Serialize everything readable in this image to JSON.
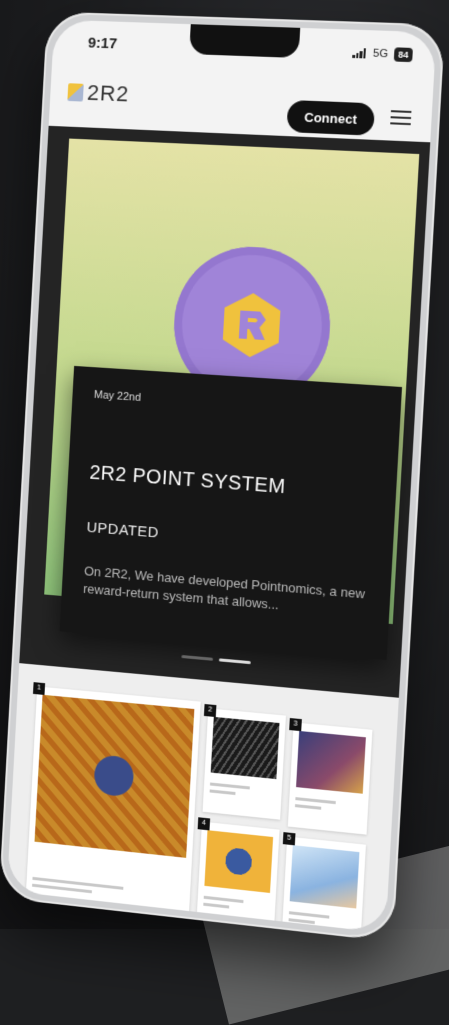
{
  "status_bar": {
    "time": "9:17",
    "network": "5G",
    "battery": "84"
  },
  "header": {
    "logo_text": "2R2",
    "connect_label": "Connect"
  },
  "hero": {
    "news": {
      "date": "May 22nd",
      "title": "2R2 POINT SYSTEM",
      "subtitle": "UPDATED",
      "body": "On 2R2, We have developed Pointnomics, a new reward-return system that allows..."
    },
    "carousel": {
      "pages": 2,
      "active_index": 1
    }
  },
  "colors": {
    "hero_gradient_top": "#e4e2a6",
    "hero_gradient_bottom": "#8fc57b",
    "coin": "#a084d8",
    "coin_mark": "#f0c23d",
    "news_card": "#161616",
    "connect_button": "#111111"
  },
  "gallery": {
    "featured": {
      "rank": "1"
    },
    "tiles": [
      {
        "rank": "2"
      },
      {
        "rank": "3"
      },
      {
        "rank": "4"
      },
      {
        "rank": "5"
      }
    ]
  },
  "icons": {
    "menu": "hamburger-icon",
    "logo": "2r2-logo-icon",
    "coin": "2r2-coin-icon"
  }
}
